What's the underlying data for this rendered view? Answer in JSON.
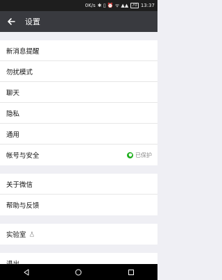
{
  "status_bar": {
    "network_speed": "0K/s",
    "icons": "✱ ▯ ⏰ ᯤ ▲▲",
    "battery": "70",
    "time": "13:37"
  },
  "app_bar": {
    "title": "设置",
    "back_icon": "arrow-left"
  },
  "groups": [
    {
      "items": [
        {
          "label": "新消息提醒"
        },
        {
          "label": "勿扰模式"
        },
        {
          "label": "聊天"
        },
        {
          "label": "隐私"
        },
        {
          "label": "通用"
        },
        {
          "label": "帐号与安全",
          "status": "已保护",
          "status_color": "#1aad19"
        }
      ]
    },
    {
      "items": [
        {
          "label": "关于微信"
        },
        {
          "label": "帮助与反馈"
        }
      ]
    },
    {
      "items": [
        {
          "label": "实验室"
        }
      ]
    },
    {
      "items": [
        {
          "label": "退出"
        }
      ]
    }
  ],
  "colors": {
    "app_bar": "#393a3f",
    "background": "#efeff4",
    "accent_green": "#1aad19"
  }
}
